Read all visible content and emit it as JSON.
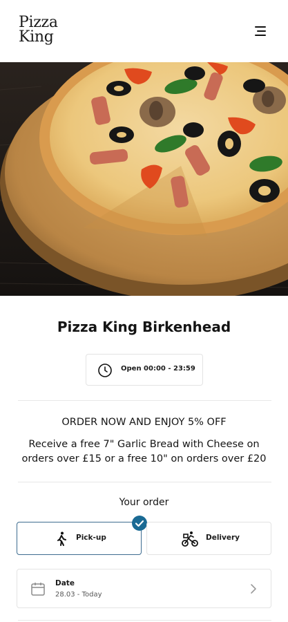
{
  "brand": {
    "logo_line1": "Pizza",
    "logo_line2": "King"
  },
  "header": {
    "menu_icon": "hamburger-menu-icon"
  },
  "hero": {
    "image": "pizza-photo"
  },
  "store": {
    "name": "Pizza King Birkenhead",
    "hours": "Open 00:00 - 23:59",
    "hours_icon": "clock-icon"
  },
  "promo": {
    "headline": "ORDER NOW AND ENJOY 5% OFF",
    "body": "Receive a free 7\" Garlic Bread with Cheese on orders over £15 or a free 10\" on orders over £20"
  },
  "order": {
    "label": "Your order",
    "options": [
      {
        "label": "Pick-up",
        "icon": "walking-person-icon",
        "selected": true
      },
      {
        "label": "Delivery",
        "icon": "bicycle-courier-icon",
        "selected": false
      }
    ],
    "date": {
      "label": "Date",
      "value": "28.03 - Today",
      "icon": "calendar-icon"
    }
  },
  "colors": {
    "accent": "#1a6a94",
    "selected_border": "#3c6b8f",
    "text": "#151515",
    "divider": "#e7e7e7"
  }
}
